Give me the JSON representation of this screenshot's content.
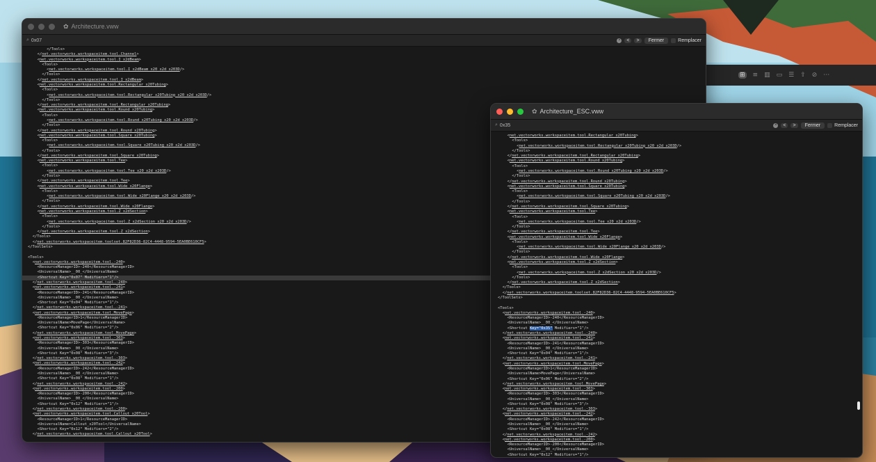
{
  "colors": {
    "close": "#ff5f57",
    "minimize": "#febc2e",
    "zoom": "#28c840",
    "inactive": "#4a4a4a",
    "selection": "#2d5fa8"
  },
  "sidebar_icons": [
    "⊞",
    "≡",
    "▥",
    "▭",
    "☰",
    "⇧",
    "⊘",
    "⋯"
  ],
  "win1": {
    "title": "Architecture.vww",
    "search": "0x07",
    "search_icon": "magnifier-icon",
    "prev": "<",
    "next": ">",
    "close_btn": "Fermer",
    "replace_label": "Remplacer",
    "lines": [
      {
        "i": 8,
        "t": "</Tools>"
      },
      {
        "i": 4,
        "t": "</net.vectorworks.workspaceitem.tool.Channel>"
      },
      {
        "i": 4,
        "t": "<net.vectorworks.workspaceitem.tool.I_x2dBeam>"
      },
      {
        "i": 6,
        "t": "<Tools>"
      },
      {
        "i": 8,
        "t": "<net.vectorworks.workspaceitem.tool.I_x2dBeam_x20_x2d_x203D/>"
      },
      {
        "i": 6,
        "t": "</Tools>"
      },
      {
        "i": 4,
        "t": "</net.vectorworks.workspaceitem.tool.I_x2dBeam>"
      },
      {
        "i": 4,
        "t": "<net.vectorworks.workspaceitem.tool.Rectangular_x20Tubing>"
      },
      {
        "i": 6,
        "t": "<Tools>"
      },
      {
        "i": 8,
        "t": "<net.vectorworks.workspaceitem.tool.Rectangular_x20Tubing_x20_x2d_x203D/>"
      },
      {
        "i": 6,
        "t": "</Tools>"
      },
      {
        "i": 4,
        "t": "</net.vectorworks.workspaceitem.tool.Rectangular_x20Tubing>"
      },
      {
        "i": 4,
        "t": "<net.vectorworks.workspaceitem.tool.Round_x20Tubing>"
      },
      {
        "i": 6,
        "t": "<Tools>"
      },
      {
        "i": 8,
        "t": "<net.vectorworks.workspaceitem.tool.Round_x20Tubing_x20_x2d_x203D/>"
      },
      {
        "i": 6,
        "t": "</Tools>"
      },
      {
        "i": 4,
        "t": "</net.vectorworks.workspaceitem.tool.Round_x20Tubing>"
      },
      {
        "i": 4,
        "t": "<net.vectorworks.workspaceitem.tool.Square_x20Tubing>"
      },
      {
        "i": 6,
        "t": "<Tools>"
      },
      {
        "i": 8,
        "t": "<net.vectorworks.workspaceitem.tool.Square_x20Tubing_x20_x2d_x203D/>"
      },
      {
        "i": 6,
        "t": "</Tools>"
      },
      {
        "i": 4,
        "t": "</net.vectorworks.workspaceitem.tool.Square_x20Tubing>"
      },
      {
        "i": 4,
        "t": "<net.vectorworks.workspaceitem.tool.Tee>"
      },
      {
        "i": 6,
        "t": "<Tools>"
      },
      {
        "i": 8,
        "t": "<net.vectorworks.workspaceitem.tool.Tee_x20_x2d_x203D/>"
      },
      {
        "i": 6,
        "t": "</Tools>"
      },
      {
        "i": 4,
        "t": "</net.vectorworks.workspaceitem.tool.Tee>"
      },
      {
        "i": 4,
        "t": "<net.vectorworks.workspaceitem.tool.Wide_x20Flange>"
      },
      {
        "i": 6,
        "t": "<Tools>"
      },
      {
        "i": 8,
        "t": "<net.vectorworks.workspaceitem.tool.Wide_x20Flange_x20_x2d_x203D/>"
      },
      {
        "i": 6,
        "t": "</Tools>"
      },
      {
        "i": 4,
        "t": "</net.vectorworks.workspaceitem.tool.Wide_x20Flange>"
      },
      {
        "i": 4,
        "t": "<net.vectorworks.workspaceitem.tool.Z_x2dSection>"
      },
      {
        "i": 6,
        "t": "<Tools>"
      },
      {
        "i": 8,
        "t": "<net.vectorworks.workspaceitem.tool.Z_x2dSection_x20_x2d_x203D/>"
      },
      {
        "i": 6,
        "t": "</Tools>"
      },
      {
        "i": 4,
        "t": "</net.vectorworks.workspaceitem.tool.Z_x2dSection>"
      },
      {
        "i": 2,
        "t": "</Tools>"
      },
      {
        "i": 2,
        "t": "</net.vectorworks.workspaceitem.toolset.82F82D36-82C4-4448-9594-5EA0BE610CF5>"
      },
      {
        "i": 0,
        "t": "</ToolSets>"
      },
      {
        "i": 0,
        "t": ""
      },
      {
        "i": 0,
        "t": "<Tools>"
      },
      {
        "i": 2,
        "t": "<net.vectorworks.workspaceitem.tool.-240>"
      },
      {
        "i": 4,
        "t": "<ResourceManagerID>-240</ResourceManagerID>"
      },
      {
        "i": 4,
        "t": "<UniversalName>__00_</UniversalName>"
      },
      {
        "i": 4,
        "t": "<Shortcut Key=\"0x07\" Modifiers=\"1\"/>"
      },
      {
        "i": 2,
        "t": "</net.vectorworks.workspaceitem.tool.-240>"
      },
      {
        "i": 2,
        "t": "<net.vectorworks.workspaceitem.tool.-241>"
      },
      {
        "i": 4,
        "t": "<ResourceManagerID>-241</ResourceManagerID>"
      },
      {
        "i": 4,
        "t": "<UniversalName>__00_</UniversalName>"
      },
      {
        "i": 4,
        "t": "<Shortcut Key=\"0x04\" Modifiers=\"1\"/>"
      },
      {
        "i": 2,
        "t": "</net.vectorworks.workspaceitem.tool.-241>"
      },
      {
        "i": 2,
        "t": "<net.vectorworks.workspaceitem.tool.MovePage>"
      },
      {
        "i": 4,
        "t": "<ResourceManagerID>1</ResourceManagerID>"
      },
      {
        "i": 4,
        "t": "<UniversalName>MovePage</UniversalName>"
      },
      {
        "i": 4,
        "t": "<Shortcut Key=\"0x06\" Modifiers=\"2\"/>"
      },
      {
        "i": 2,
        "t": "</net.vectorworks.workspaceitem.tool.MovePage>"
      },
      {
        "i": 2,
        "t": "<net.vectorworks.workspaceitem.tool.-303>"
      },
      {
        "i": 4,
        "t": "<ResourceManagerID>-303</ResourceManagerID>"
      },
      {
        "i": 4,
        "t": "<UniversalName>__00_</UniversalName>"
      },
      {
        "i": 4,
        "t": "<Shortcut Key=\"0x08\" Modifiers=\"3\"/>"
      },
      {
        "i": 2,
        "t": "</net.vectorworks.workspaceitem.tool.-303>"
      },
      {
        "i": 2,
        "t": "<net.vectorworks.workspaceitem.tool.-242>"
      },
      {
        "i": 4,
        "t": "<ResourceManagerID>-242</ResourceManagerID>"
      },
      {
        "i": 4,
        "t": "<UniversalName>__00_</UniversalName>"
      },
      {
        "i": 4,
        "t": "<Shortcut Key=\"0x08\" Modifiers=\"1\"/>"
      },
      {
        "i": 2,
        "t": "</net.vectorworks.workspaceitem.tool.-242>"
      },
      {
        "i": 2,
        "t": "<net.vectorworks.workspaceitem.tool.-200>"
      },
      {
        "i": 4,
        "t": "<ResourceManagerID>-200</ResourceManagerID>"
      },
      {
        "i": 4,
        "t": "<UniversalName>__00_</UniversalName>"
      },
      {
        "i": 4,
        "t": "<Shortcut Key=\"0x12\" Modifiers=\"1\"/>"
      },
      {
        "i": 2,
        "t": "</net.vectorworks.workspaceitem.tool.-200>"
      },
      {
        "i": 2,
        "t": "<net.vectorworks.workspaceitem.tool.Callout_x20Tool>"
      },
      {
        "i": 4,
        "t": "<ResourceManagerID>1</ResourceManagerID>"
      },
      {
        "i": 4,
        "t": "<UniversalName>Callout_x20Tool</UniversalName>"
      },
      {
        "i": 4,
        "t": "<Shortcut Key=\"0x12\" Modifiers=\"2\"/>"
      },
      {
        "i": 2,
        "t": "</net.vectorworks.workspaceitem.tool.Callout_x20Tool>"
      }
    ]
  },
  "win2": {
    "title": "Architecture_ESC.vww",
    "search": "0x35",
    "search_icon": "magnifier-icon",
    "prev": "<",
    "next": ">",
    "close_btn": "Fermer",
    "replace_label": "Remplacer",
    "lines": [
      {
        "i": 4,
        "t": "<net.vectorworks.workspaceitem.tool.Rectangular_x20Tubing>"
      },
      {
        "i": 6,
        "t": "<Tools>"
      },
      {
        "i": 8,
        "t": "<net.vectorworks.workspaceitem.tool.Rectangular_x20Tubing_x20_x2d_x203D/>"
      },
      {
        "i": 6,
        "t": "</Tools>"
      },
      {
        "i": 4,
        "t": "</net.vectorworks.workspaceitem.tool.Rectangular_x20Tubing>"
      },
      {
        "i": 4,
        "t": "<net.vectorworks.workspaceitem.tool.Round_x20Tubing>"
      },
      {
        "i": 6,
        "t": "<Tools>"
      },
      {
        "i": 8,
        "t": "<net.vectorworks.workspaceitem.tool.Round_x20Tubing_x20_x2d_x203D/>"
      },
      {
        "i": 6,
        "t": "</Tools>"
      },
      {
        "i": 4,
        "t": "</net.vectorworks.workspaceitem.tool.Round_x20Tubing>"
      },
      {
        "i": 4,
        "t": "<net.vectorworks.workspaceitem.tool.Square_x20Tubing>"
      },
      {
        "i": 6,
        "t": "<Tools>"
      },
      {
        "i": 8,
        "t": "<net.vectorworks.workspaceitem.tool.Square_x20Tubing_x20_x2d_x203D/>"
      },
      {
        "i": 6,
        "t": "</Tools>"
      },
      {
        "i": 4,
        "t": "</net.vectorworks.workspaceitem.tool.Square_x20Tubing>"
      },
      {
        "i": 4,
        "t": "<net.vectorworks.workspaceitem.tool.Tee>"
      },
      {
        "i": 6,
        "t": "<Tools>"
      },
      {
        "i": 8,
        "t": "<net.vectorworks.workspaceitem.tool.Tee_x20_x2d_x203D/>"
      },
      {
        "i": 6,
        "t": "</Tools>"
      },
      {
        "i": 4,
        "t": "</net.vectorworks.workspaceitem.tool.Tee>"
      },
      {
        "i": 4,
        "t": "<net.vectorworks.workspaceitem.tool.Wide_x20Flange>"
      },
      {
        "i": 6,
        "t": "<Tools>"
      },
      {
        "i": 8,
        "t": "<net.vectorworks.workspaceitem.tool.Wide_x20Flange_x20_x2d_x203D/>"
      },
      {
        "i": 6,
        "t": "</Tools>"
      },
      {
        "i": 4,
        "t": "</net.vectorworks.workspaceitem.tool.Wide_x20Flange>"
      },
      {
        "i": 4,
        "t": "<net.vectorworks.workspaceitem.tool.Z_x2dSection>"
      },
      {
        "i": 6,
        "t": "<Tools>"
      },
      {
        "i": 8,
        "t": "<net.vectorworks.workspaceitem.tool.Z_x2dSection_x20_x2d_x203D/>"
      },
      {
        "i": 6,
        "t": "</Tools>"
      },
      {
        "i": 4,
        "t": "</net.vectorworks.workspaceitem.tool.Z_x2dSection>"
      },
      {
        "i": 2,
        "t": "</Tools>"
      },
      {
        "i": 2,
        "t": "</net.vectorworks.workspaceitem.toolset.82F82D36-82C4-4448-9594-5EA0BE610CF5>"
      },
      {
        "i": 0,
        "t": "</ToolSets>"
      },
      {
        "i": 0,
        "t": ""
      },
      {
        "i": 0,
        "t": "<Tools>"
      },
      {
        "i": 2,
        "t": "<net.vectorworks.workspaceitem.tool.-240>"
      },
      {
        "i": 4,
        "t": "<ResourceManagerID>-240</ResourceManagerID>"
      },
      {
        "i": 4,
        "t": "<UniversalName>__00_</UniversalName>"
      },
      {
        "i": 4,
        "t": "<Shortcut Key=\"0x35\" Modifiers=\"1\"/>"
      },
      {
        "i": 2,
        "t": "</net.vectorworks.workspaceitem.tool.-240>"
      },
      {
        "i": 2,
        "t": "<net.vectorworks.workspaceitem.tool.-241>"
      },
      {
        "i": 4,
        "t": "<ResourceManagerID>-241</ResourceManagerID>"
      },
      {
        "i": 4,
        "t": "<UniversalName>__00_</UniversalName>"
      },
      {
        "i": 4,
        "t": "<Shortcut Key=\"0x04\" Modifiers=\"1\"/>"
      },
      {
        "i": 2,
        "t": "</net.vectorworks.workspaceitem.tool.-241>"
      },
      {
        "i": 2,
        "t": "<net.vectorworks.workspaceitem.tool.MovePage>"
      },
      {
        "i": 4,
        "t": "<ResourceManagerID>1</ResourceManagerID>"
      },
      {
        "i": 4,
        "t": "<UniversalName>MovePage</UniversalName>"
      },
      {
        "i": 4,
        "t": "<Shortcut Key=\"0x06\" Modifiers=\"2\"/>"
      },
      {
        "i": 2,
        "t": "</net.vectorworks.workspaceitem.tool.MovePage>"
      },
      {
        "i": 2,
        "t": "<net.vectorworks.workspaceitem.tool.-303>"
      },
      {
        "i": 4,
        "t": "<ResourceManagerID>-303</ResourceManagerID>"
      },
      {
        "i": 4,
        "t": "<UniversalName>__00_</UniversalName>"
      },
      {
        "i": 4,
        "t": "<Shortcut Key=\"0x08\" Modifiers=\"3\"/>"
      },
      {
        "i": 2,
        "t": "</net.vectorworks.workspaceitem.tool.-303>"
      },
      {
        "i": 2,
        "t": "<net.vectorworks.workspaceitem.tool.-242>"
      },
      {
        "i": 4,
        "t": "<ResourceManagerID>-242</ResourceManagerID>"
      },
      {
        "i": 4,
        "t": "<UniversalName>__00_</UniversalName>"
      },
      {
        "i": 4,
        "t": "<Shortcut Key=\"0x08\" Modifiers=\"1\"/>"
      },
      {
        "i": 2,
        "t": "</net.vectorworks.workspaceitem.tool.-242>"
      },
      {
        "i": 2,
        "t": "<net.vectorworks.workspaceitem.tool.-200>"
      },
      {
        "i": 4,
        "t": "<ResourceManagerID>-200</ResourceManagerID>"
      },
      {
        "i": 4,
        "t": "<UniversalName>__00_</UniversalName>"
      },
      {
        "i": 4,
        "t": "<Shortcut Key=\"0x12\" Modifiers=\"1\"/>"
      }
    ]
  }
}
